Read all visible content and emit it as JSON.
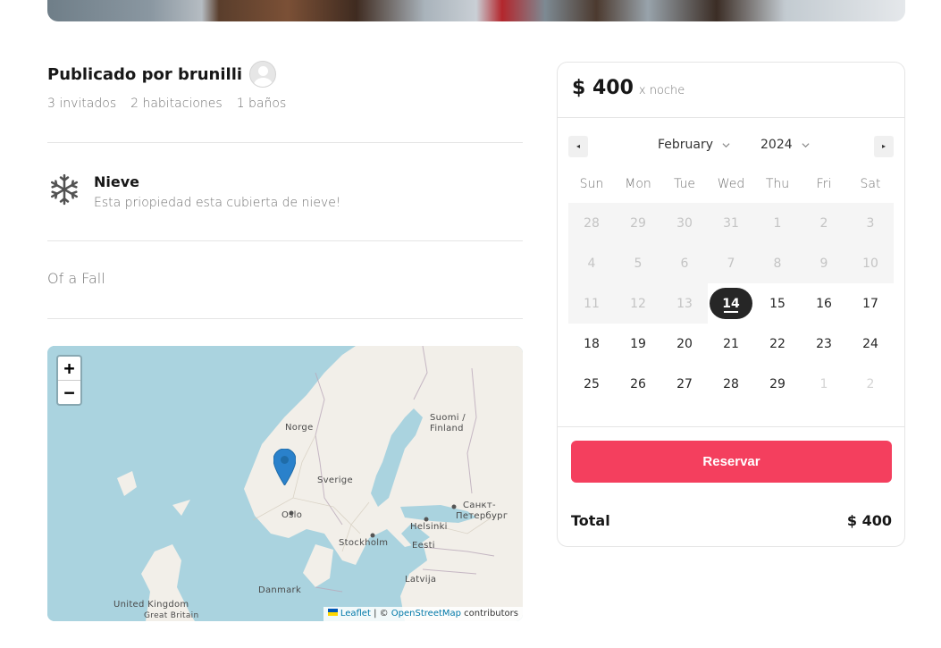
{
  "host": {
    "title": "Publicado por brunilli",
    "stats": [
      "3 invitados",
      "2 habitaciones",
      "1 baños"
    ]
  },
  "feature": {
    "icon": "snowflake-icon",
    "title": "Nieve",
    "description": "Esta priopiedad esta cubierta de nieve!"
  },
  "listing": {
    "description": "Of a Fall"
  },
  "map": {
    "zoom_in": "+",
    "zoom_out": "−",
    "labels": {
      "norge": "Norge",
      "sverige": "Sverige",
      "suomi": "Suomi /",
      "finland": "Finland",
      "oslo": "Oslo",
      "stockholm": "Stockholm",
      "helsinki": "Helsinki",
      "sankt": "Санкт-",
      "peterburg": "Петербург",
      "eesti": "Eesti",
      "latvija": "Latvija",
      "danmark": "Danmark",
      "uk": "United Kingdom",
      "gb": "Great Britain"
    },
    "attribution": {
      "leaflet": "Leaflet",
      "separator": " | © ",
      "osm": "OpenStreetMap",
      "contributors": " contributors"
    }
  },
  "booking": {
    "price": "$ 400",
    "per_night": "x noche",
    "calendar": {
      "month": "February",
      "year": "2024",
      "prev": "◂",
      "next": "▸",
      "weekdays": [
        "Sun",
        "Mon",
        "Tue",
        "Wed",
        "Thu",
        "Fri",
        "Sat"
      ],
      "days": [
        {
          "d": "28",
          "s": "disabled"
        },
        {
          "d": "29",
          "s": "disabled"
        },
        {
          "d": "30",
          "s": "disabled"
        },
        {
          "d": "31",
          "s": "disabled"
        },
        {
          "d": "1",
          "s": "disabled"
        },
        {
          "d": "2",
          "s": "disabled"
        },
        {
          "d": "3",
          "s": "disabled"
        },
        {
          "d": "4",
          "s": "disabled"
        },
        {
          "d": "5",
          "s": "disabled"
        },
        {
          "d": "6",
          "s": "disabled"
        },
        {
          "d": "7",
          "s": "disabled"
        },
        {
          "d": "8",
          "s": "disabled"
        },
        {
          "d": "9",
          "s": "disabled"
        },
        {
          "d": "10",
          "s": "disabled"
        },
        {
          "d": "11",
          "s": "disabled"
        },
        {
          "d": "12",
          "s": "disabled"
        },
        {
          "d": "13",
          "s": "disabled"
        },
        {
          "d": "14",
          "s": "selected"
        },
        {
          "d": "15",
          "s": "available"
        },
        {
          "d": "16",
          "s": "available"
        },
        {
          "d": "17",
          "s": "available"
        },
        {
          "d": "18",
          "s": "available"
        },
        {
          "d": "19",
          "s": "available"
        },
        {
          "d": "20",
          "s": "available"
        },
        {
          "d": "21",
          "s": "available"
        },
        {
          "d": "22",
          "s": "available"
        },
        {
          "d": "23",
          "s": "available"
        },
        {
          "d": "24",
          "s": "available"
        },
        {
          "d": "25",
          "s": "available"
        },
        {
          "d": "26",
          "s": "available"
        },
        {
          "d": "27",
          "s": "available"
        },
        {
          "d": "28",
          "s": "available"
        },
        {
          "d": "29",
          "s": "available"
        },
        {
          "d": "1",
          "s": "outside"
        },
        {
          "d": "2",
          "s": "outside"
        }
      ]
    },
    "reserve_label": "Reservar",
    "total_label": "Total",
    "total_value": "$ 400",
    "accent_color": "#f43f5e"
  }
}
